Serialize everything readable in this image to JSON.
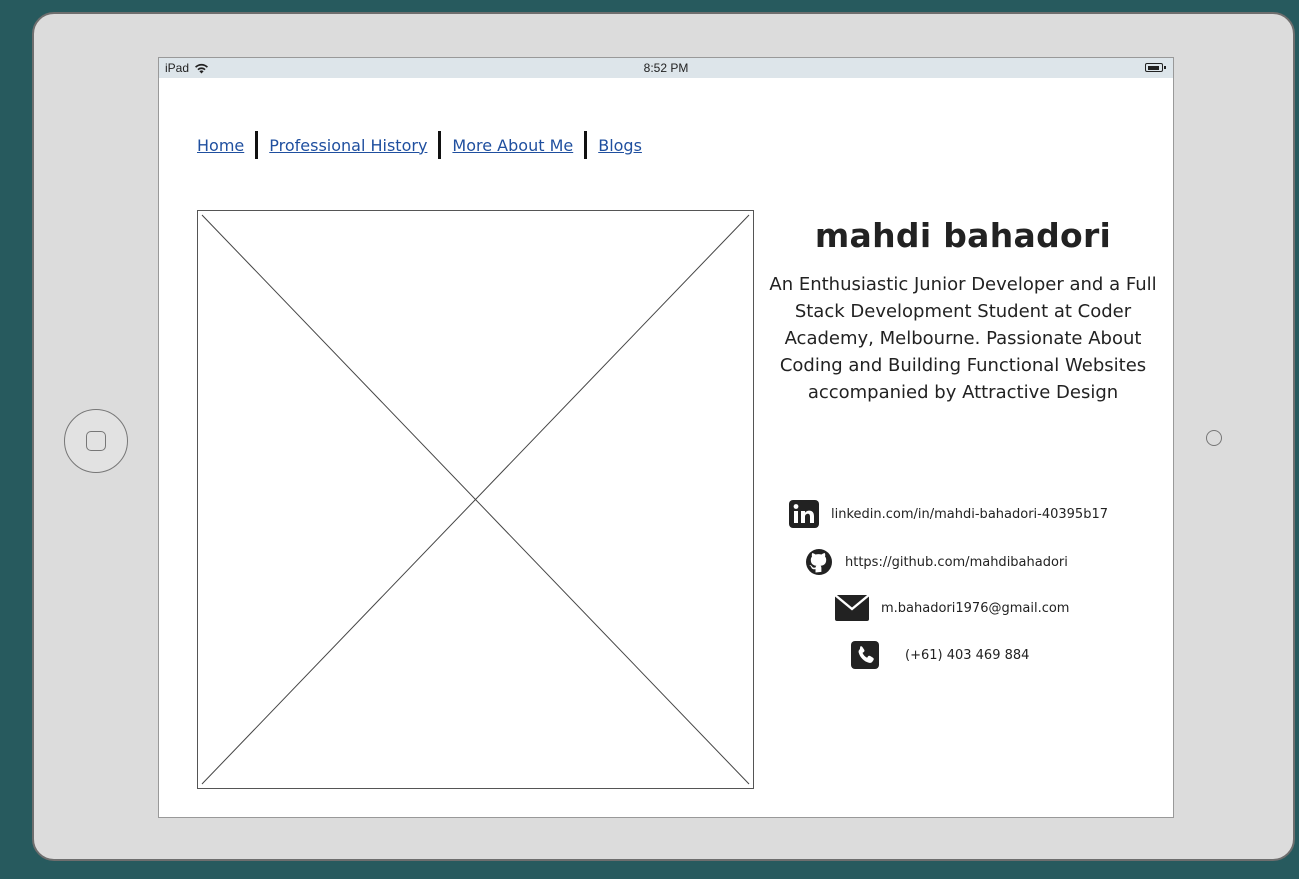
{
  "statusbar": {
    "carrier": "iPad",
    "time": "8:52 PM"
  },
  "nav": {
    "items": [
      {
        "label": "Home"
      },
      {
        "label": "Professional History"
      },
      {
        "label": "More About Me"
      },
      {
        "label": "Blogs"
      }
    ]
  },
  "profile": {
    "name": "mahdi bahadori",
    "bio": "An Enthusiastic Junior Developer and a Full Stack Development Student at Coder Academy, Melbourne. Passionate About Coding and Building Functional Websites accompanied by Attractive Design"
  },
  "contacts": {
    "linkedin": {
      "text": "linkedin.com/in/mahdi-bahadori-40395b17",
      "icon": "linkedin-icon"
    },
    "github": {
      "text": "https://github.com/mahdibahadori",
      "icon": "github-icon"
    },
    "email": {
      "text": "m.bahadori1976@gmail.com",
      "icon": "envelope-icon"
    },
    "phone": {
      "text": "(+61) 403 469 884",
      "icon": "phone-icon"
    }
  },
  "colors": {
    "background": "#275a5e",
    "device_frame": "#dcdcdc",
    "link": "#1f4f9f",
    "text": "#222222"
  }
}
